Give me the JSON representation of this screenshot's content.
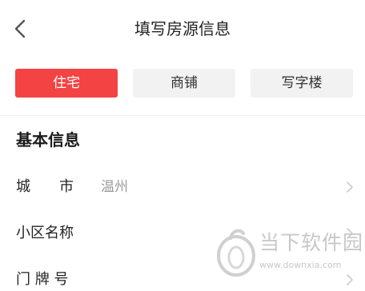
{
  "header": {
    "title": "填写房源信息"
  },
  "tabs": [
    {
      "label": "住宅",
      "selected": true
    },
    {
      "label": "商铺",
      "selected": false
    },
    {
      "label": "写字楼",
      "selected": false
    }
  ],
  "section": {
    "title": "基本信息"
  },
  "rows": [
    {
      "label": "城　　市",
      "value": "温州"
    },
    {
      "label": "小区名称",
      "value": ""
    },
    {
      "label": "门 牌 号",
      "value": ""
    }
  ],
  "watermark": {
    "name": "当下软件园",
    "url": "www.downxia.com"
  },
  "colors": {
    "accent": "#f34343",
    "tab_inactive_bg": "#f2f2f2",
    "muted_text": "#999999"
  }
}
